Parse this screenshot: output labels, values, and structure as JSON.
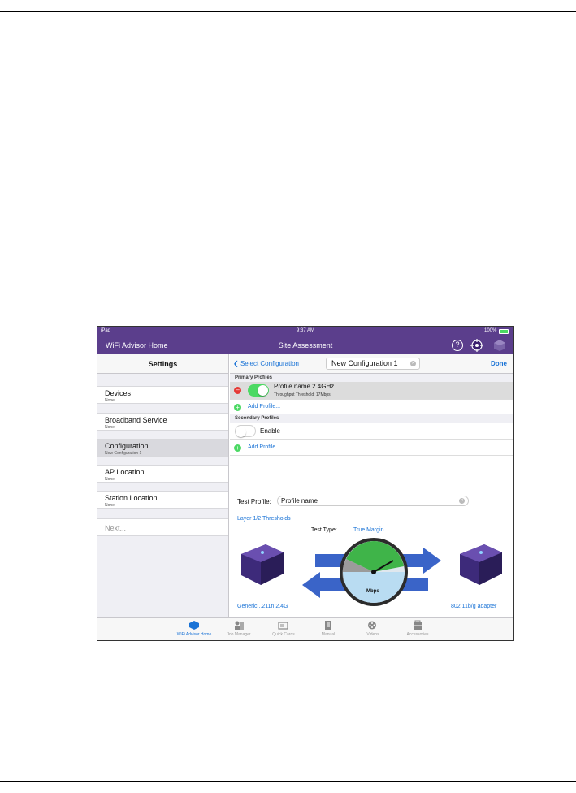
{
  "statusbar": {
    "device": "iPad",
    "time": "9:37 AM",
    "battery": "100%"
  },
  "navbar": {
    "home": "WiFi Advisor Home",
    "title": "Site Assessment",
    "help": "?"
  },
  "sidebar": {
    "title": "Settings",
    "items": [
      {
        "label": "Devices",
        "sub": "None"
      },
      {
        "label": "Broadband Service",
        "sub": "None"
      },
      {
        "label": "Configuration",
        "sub": "New Configuration 1"
      },
      {
        "label": "AP Location",
        "sub": "None"
      },
      {
        "label": "Station Location",
        "sub": "None"
      }
    ],
    "next": "Next..."
  },
  "main": {
    "back": "Select Configuration",
    "config_name": "New Configuration 1",
    "done": "Done",
    "primary_header": "Primary Profiles",
    "profile": {
      "name": "Profile name  2.4GHz",
      "threshold": "Throughput Threshold: 17Mbps"
    },
    "add_profile": "Add Profile...",
    "secondary_header": "Secondary Profiles",
    "enable": "Enable",
    "add_profile_2": "Add Profile...",
    "test_profile_label": "Test Profile:",
    "test_profile_value": "Profile name",
    "thresholds_link": "Layer 1/2 Thresholds",
    "test_type_label": "Test Type:",
    "test_type_value": "True Margin",
    "gauge_unit": "Mbps",
    "left_device": "Generic...211n 2.4G",
    "right_device": "802.11b/g adapter"
  },
  "tabbar": [
    {
      "label": "WiFi Advisor Home",
      "icon": "wifi-advisor-home-icon"
    },
    {
      "label": "Job Manager",
      "icon": "job-manager-icon"
    },
    {
      "label": "Quick Cards",
      "icon": "quick-cards-icon"
    },
    {
      "label": "Manual",
      "icon": "manual-icon"
    },
    {
      "label": "Videos",
      "icon": "videos-icon"
    },
    {
      "label": "Accessories",
      "icon": "accessories-icon"
    }
  ],
  "colors": {
    "purple": "#5b3e8c",
    "blue": "#1a73d6",
    "green": "#4cd964",
    "red": "#e53935",
    "arrow": "#3a64c8"
  }
}
